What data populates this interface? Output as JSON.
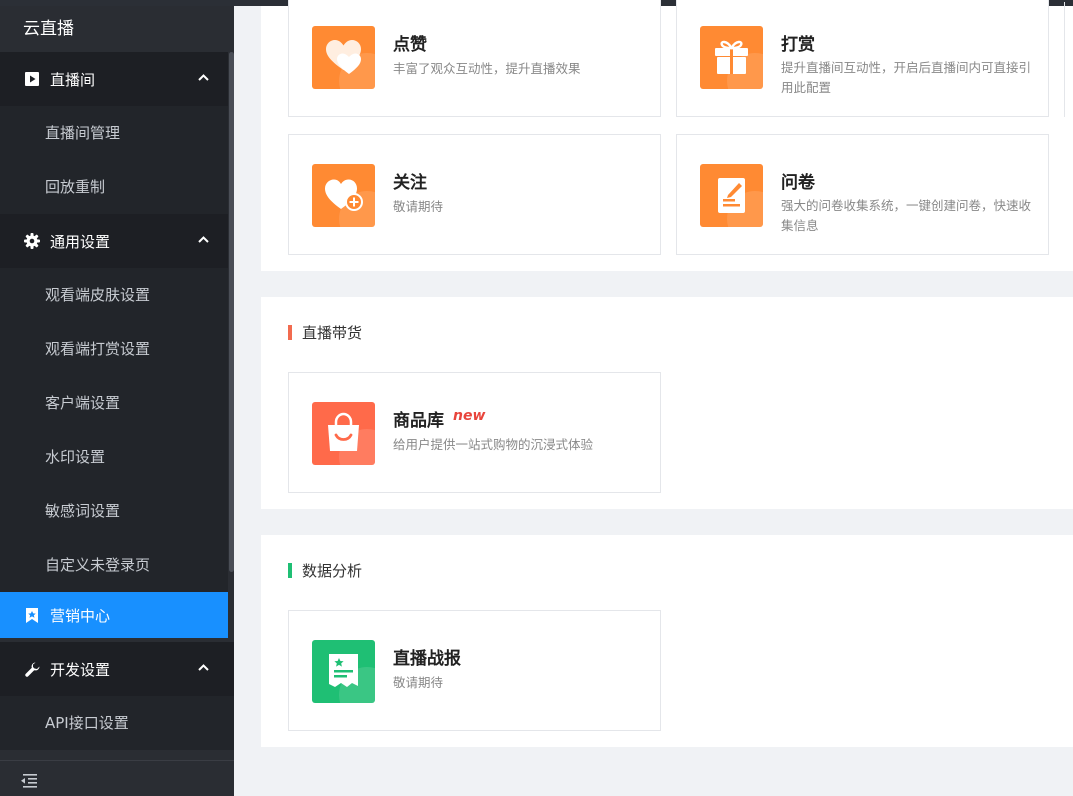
{
  "sidebar": {
    "brand": "云直播",
    "groups": [
      {
        "label": "直播间",
        "icon": "play-icon",
        "items": [
          "直播间管理",
          "回放重制"
        ]
      },
      {
        "label": "通用设置",
        "icon": "gear-icon",
        "items": [
          "观看端皮肤设置",
          "观看端打赏设置",
          "客户端设置",
          "水印设置",
          "敏感词设置",
          "自定义未登录页"
        ]
      },
      {
        "label": "营销中心",
        "icon": "bookmark-icon",
        "active": true
      },
      {
        "label": "开发设置",
        "icon": "wrench-icon",
        "items": [
          "API接口设置"
        ]
      }
    ]
  },
  "sections": {
    "interaction": {
      "cards": [
        {
          "title": "点赞",
          "desc": "丰富了观众互动性，提升直播效果",
          "icon": "heart-like-icon"
        },
        {
          "title": "打赏",
          "desc": "提升直播间互动性，开启后直播间内可直接引用此配置",
          "icon": "gift-icon"
        },
        {
          "title": "关注",
          "desc": "敬请期待",
          "icon": "heart-plus-icon"
        },
        {
          "title": "问卷",
          "desc": "强大的问卷收集系统，一键创建问卷，快速收集信息",
          "icon": "questionnaire-icon"
        }
      ]
    },
    "commerce": {
      "title": "直播带货",
      "cards": [
        {
          "title": "商品库",
          "tag": "new",
          "desc": "给用户提供一站式购物的沉浸式体验",
          "icon": "shopping-bag-icon"
        }
      ]
    },
    "analytics": {
      "title": "数据分析",
      "cards": [
        {
          "title": "直播战报",
          "desc": "敬请期待",
          "icon": "report-icon"
        }
      ]
    }
  },
  "colors": {
    "orange": "#ff8a33",
    "red_orange": "#ff6a4a",
    "green": "#1fbf74",
    "commerce_bar": "#f26b4f",
    "analytics_bar": "#1fbf74",
    "active_blue": "#1890ff"
  }
}
